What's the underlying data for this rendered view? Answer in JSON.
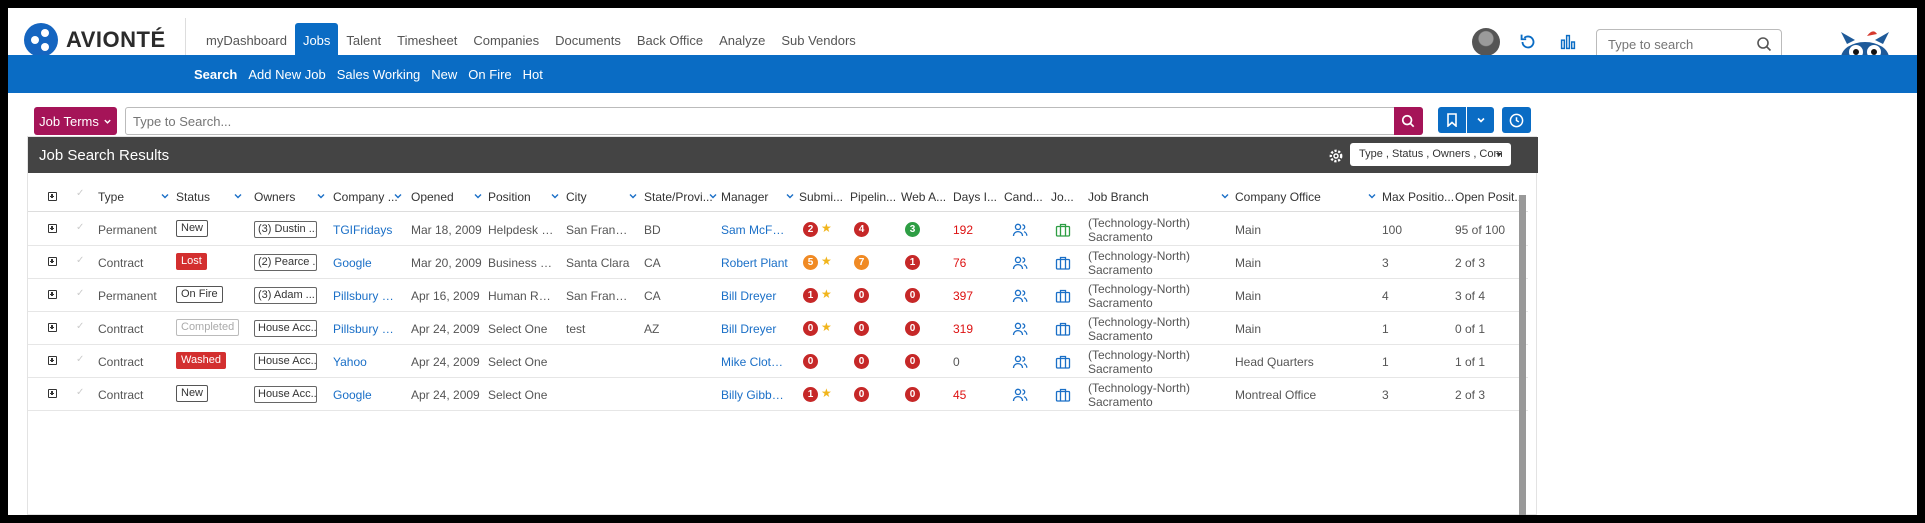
{
  "app": {
    "logo_text": "AVIONTÉ",
    "nav": [
      "myDashboard",
      "Jobs",
      "Talent",
      "Timesheet",
      "Companies",
      "Documents",
      "Back Office",
      "Analyze",
      "Sub Vendors"
    ],
    "search_placeholder": "Type to search"
  },
  "subnav": [
    "Search",
    "Add New Job",
    "Sales Working",
    "New",
    "On Fire",
    "Hot"
  ],
  "search": {
    "job_terms_label": "Job Terms",
    "placeholder": "Type to Search..."
  },
  "results": {
    "title": "Job Search Results",
    "filter_label": "Type , Status , Owners , Com"
  },
  "columns": [
    "Type",
    "Status",
    "Owners",
    "Company ...",
    "Opened",
    "Position",
    "City",
    "State/Provi...",
    "Manager",
    "Submi...",
    "Pipelin...",
    "Web A...",
    "Days I...",
    "Cand...",
    "Jo...",
    "Job Branch",
    "Company Office",
    "Max Positio...",
    "Open Posit..."
  ],
  "rows": [
    {
      "type": "Permanent",
      "status": "New",
      "status_style": "outline",
      "owners": "(3) Dustin ...",
      "company": "TGIFridays",
      "opened": "Mar 18, 2009",
      "position": "Helpdesk S...",
      "city": "San Francis...",
      "state": "BD",
      "manager": "Sam McFarl...",
      "submit": "2",
      "submit_color": "red",
      "submit_star": true,
      "pipeline": "4",
      "pipeline_color": "red",
      "web": "3",
      "web_color": "green",
      "days": "192",
      "job_icon": "green",
      "branch_1": "(Technology-North)",
      "branch_2": "Sacramento",
      "office": "Main",
      "max": "100",
      "open": "95 of 100"
    },
    {
      "type": "Contract",
      "status": "Lost",
      "status_style": "red",
      "owners": "(2) Pearce ...",
      "company": "Google",
      "opened": "Mar 20, 2009",
      "position": "Business De...",
      "city": "Santa Clara",
      "state": "CA",
      "manager": "Robert Plant",
      "submit": "5",
      "submit_color": "orange",
      "submit_star": true,
      "pipeline": "7",
      "pipeline_color": "orange",
      "web": "1",
      "web_color": "red",
      "days": "76",
      "job_icon": "blue",
      "branch_1": "(Technology-North)",
      "branch_2": "Sacramento",
      "office": "Main",
      "max": "3",
      "open": "2 of 3"
    },
    {
      "type": "Permanent",
      "status": "On Fire",
      "status_style": "outline",
      "owners": "(3) Adam ...",
      "company": "Pillsbury Wi...",
      "opened": "Apr 16, 2009",
      "position": "Human Res...",
      "city": "San Francis...",
      "state": "CA",
      "manager": "Bill Dreyer",
      "submit": "1",
      "submit_color": "red",
      "submit_star": true,
      "pipeline": "0",
      "pipeline_color": "red",
      "web": "0",
      "web_color": "red",
      "days": "397",
      "job_icon": "blue",
      "branch_1": "(Technology-North)",
      "branch_2": "Sacramento",
      "office": "Main",
      "max": "4",
      "open": "3 of 4"
    },
    {
      "type": "Contract",
      "status": "Completed",
      "status_style": "gray",
      "owners": "House Acc...",
      "company": "Pillsbury Wi...",
      "opened": "Apr 24, 2009",
      "position": "Select One",
      "city": "test",
      "state": "AZ",
      "manager": "Bill Dreyer",
      "submit": "0",
      "submit_color": "red",
      "submit_star": true,
      "pipeline": "0",
      "pipeline_color": "red",
      "web": "0",
      "web_color": "red",
      "days": "319",
      "job_icon": "blue",
      "branch_1": "(Technology-North)",
      "branch_2": "Sacramento",
      "office": "Main",
      "max": "1",
      "open": "0 of 1"
    },
    {
      "type": "Contract",
      "status": "Washed",
      "status_style": "red",
      "owners": "House Acc...",
      "company": "Yahoo",
      "opened": "Apr 24, 2009",
      "position": "Select One",
      "city": "",
      "state": "",
      "manager": "Mike Clothier",
      "submit": "0",
      "submit_color": "red",
      "submit_star": false,
      "pipeline": "0",
      "pipeline_color": "red",
      "web": "0",
      "web_color": "red",
      "days": "0",
      "job_icon": "blue",
      "branch_1": "(Technology-North)",
      "branch_2": "Sacramento",
      "office": "Head Quarters",
      "max": "1",
      "open": "1 of 1"
    },
    {
      "type": "Contract",
      "status": "New",
      "status_style": "outline",
      "owners": "House Acc...",
      "company": "Google",
      "opened": "Apr 24, 2009",
      "position": "Select One",
      "city": "",
      "state": "",
      "manager": "Billy Gibbons",
      "submit": "1",
      "submit_color": "red",
      "submit_star": true,
      "pipeline": "0",
      "pipeline_color": "red",
      "web": "0",
      "web_color": "red",
      "days": "45",
      "job_icon": "blue",
      "branch_1": "(Technology-North)",
      "branch_2": "Sacramento",
      "office": "Montreal Office",
      "max": "3",
      "open": "2 of 3"
    }
  ],
  "colors": {
    "primary": "#0a6cc4",
    "accent": "#a51458",
    "header_dark": "#444444",
    "link": "#1a6fc7",
    "danger": "#d32f2f",
    "warning": "#f08a24",
    "success": "#2e9e44"
  },
  "icons": {
    "logo": "avionte-logo-icon",
    "refresh": "refresh-icon",
    "analytics": "bar-chart-icon",
    "search": "search-icon",
    "mascot": "owl-mascot-icon",
    "settings": "gear-icon",
    "candidates": "people-icon",
    "job": "briefcase-icon",
    "bookmark": "bookmark-icon",
    "history": "clock-icon"
  }
}
